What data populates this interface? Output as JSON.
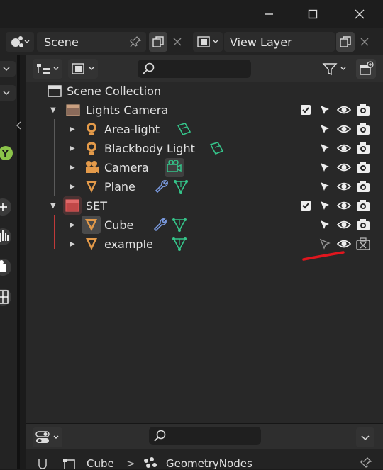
{
  "header": {
    "scene_label": "Scene",
    "view_layer_label": "View Layer"
  },
  "outliner": {
    "search_placeholder": "",
    "rows": [
      {
        "label": "Scene Collection"
      },
      {
        "label": "Lights Camera"
      },
      {
        "label": "Area-light"
      },
      {
        "label": "Blackbody Light"
      },
      {
        "label": "Camera"
      },
      {
        "label": "Plane"
      },
      {
        "label": "SET"
      },
      {
        "label": "Cube"
      },
      {
        "label": "example"
      }
    ]
  },
  "properties": {
    "breadcrumb_object": "Cube",
    "breadcrumb_modifier": "GeometryNodes",
    "separator": ">"
  },
  "colors": {
    "accent_green": "#35c48a",
    "wrench_blue": "#7a9ae0",
    "object_orange": "#e39a4a",
    "collection_red": "#e05a5a",
    "annotation_red": "#e0161e"
  }
}
